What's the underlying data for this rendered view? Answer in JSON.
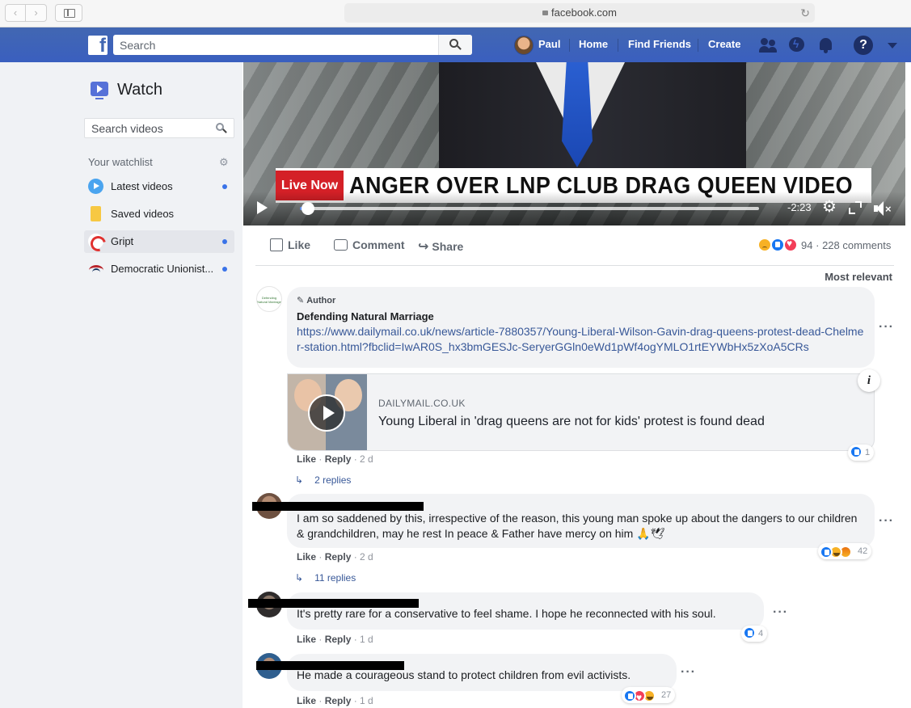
{
  "browser": {
    "back": "‹",
    "forward": "›",
    "url": "facebook.com",
    "reload": "↻"
  },
  "nav": {
    "search_placeholder": "Search",
    "user_name": "Paul",
    "home": "Home",
    "find_friends": "Find Friends",
    "create": "Create",
    "help": "?"
  },
  "sidebar": {
    "title": "Watch",
    "search_placeholder": "Search videos",
    "watchlist_heading": "Your watchlist",
    "items": [
      {
        "label": "Latest videos",
        "icon": "play-circle-icon",
        "dot": true
      },
      {
        "label": "Saved videos",
        "icon": "bookmark-icon",
        "dot": false
      },
      {
        "label": "Gript",
        "icon": "gript-logo-icon",
        "dot": true,
        "active": true
      },
      {
        "label": "Democratic Unionist...",
        "icon": "dup-logo-icon",
        "dot": true
      }
    ]
  },
  "video": {
    "live_badge": "Live Now",
    "headline": "ANGER OVER LNP CLUB DRAG QUEEN VIDEO",
    "time_remaining": "-2:23",
    "progress": 0.02
  },
  "actions": {
    "like": "Like",
    "comment": "Comment",
    "share": "Share",
    "reaction_count": "94",
    "separator": "·",
    "comments_count": "228 comments",
    "sort": "Most relevant"
  },
  "comments": [
    {
      "author_tag": "Author",
      "author": "Defending Natural Marriage",
      "avatar_text": "Defending Natural Marriage",
      "link": "https://www.dailymail.co.uk/news/article-7880357/Young-Liberal-Wilson-Gavin-drag-queens-protest-dead-Chelmer-station.html?fbclid=IwAR0S_hx3bmGESJc-SeryerGGln0eWd1pWf4ogYMLO1rtEYWbHx5zXoA5CRs",
      "preview": {
        "domain": "DAILYMAIL.CO.UK",
        "title": "Young Liberal in 'drag queens are not for kids' protest is found dead"
      },
      "like": "Like",
      "reply": "Reply",
      "time": "2 d",
      "reactions": "1",
      "replies": "2 replies"
    },
    {
      "text": "I am so saddened by this, irrespective of the reason, this young man spoke up about the dangers to our children & grandchildren, may he rest In peace & Father have mercy on him 🙏🕊",
      "like": "Like",
      "reply": "Reply",
      "time": "2 d",
      "reactions": "42",
      "replies": "11 replies"
    },
    {
      "text": "It's pretty rare for a conservative to feel shame. I hope he reconnected with his soul.",
      "like": "Like",
      "reply": "Reply",
      "time": "1 d",
      "reactions": "4"
    },
    {
      "text": "He made a courageous stand to protect children from evil activists.",
      "like": "Like",
      "reply": "Reply",
      "time": "1 d",
      "reactions": "27"
    }
  ],
  "colors": {
    "fb_blue": "#4267b2",
    "link": "#385898",
    "live_red": "#d42027",
    "seek_blue": "#5b8cf0"
  }
}
